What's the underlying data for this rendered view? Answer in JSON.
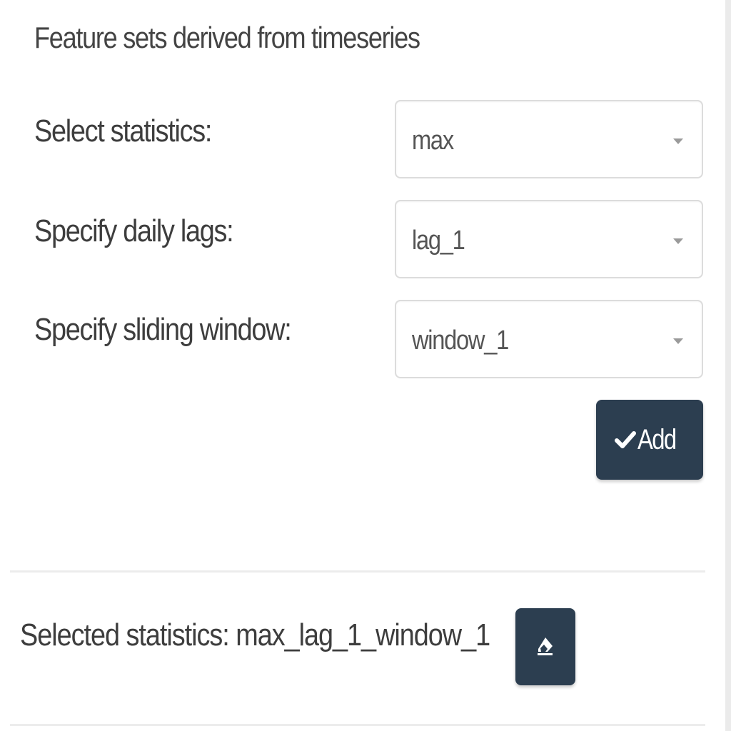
{
  "section": {
    "title": "Feature sets derived from timeseries"
  },
  "form": {
    "statistics": {
      "label": "Select statistics:",
      "value": "max"
    },
    "lags": {
      "label": "Specify daily lags:",
      "value": "lag_1"
    },
    "window": {
      "label": "Specify sliding window:",
      "value": "window_1"
    },
    "add_button": {
      "label": "Add",
      "icon": "check-icon"
    }
  },
  "selection": {
    "label": "Selected statistics:",
    "value": "max_lag_1_window_1",
    "remove_icon": "eraser-icon"
  },
  "colors": {
    "button_bg": "#2c3e50",
    "border": "#dcdcdc",
    "text": "#3d3d3d"
  }
}
